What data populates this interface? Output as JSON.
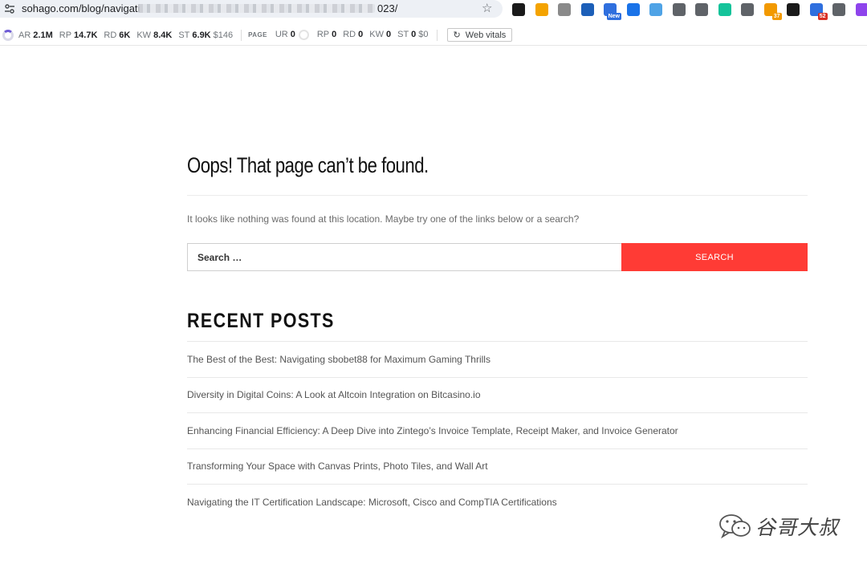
{
  "browser": {
    "url_prefix": "sohago.com/blog/navigati",
    "url_suffix": "023/",
    "extensions": [
      {
        "icon": "bookmark-arrow-icon",
        "color": "#1a1a1a",
        "badge": "",
        "badge_color": ""
      },
      {
        "icon": "sun-badge-icon",
        "color": "#f4a300",
        "badge": "",
        "badge_color": ""
      },
      {
        "icon": "document-icon",
        "color": "#8a8a8a",
        "badge": "",
        "badge_color": ""
      },
      {
        "icon": "puzzle-red-icon",
        "color": "#1c5fb8",
        "badge": "",
        "badge_color": "#d93025"
      },
      {
        "icon": "new-extension-icon",
        "color": "#2f6fde",
        "badge": "New",
        "badge_color": "#2f6fde"
      },
      {
        "icon": "circle-arrow-icon",
        "color": "#1a73e8",
        "badge": "",
        "badge_color": ""
      },
      {
        "icon": "react-atom-icon",
        "color": "#4fa3e6",
        "badge": "",
        "badge_color": ""
      },
      {
        "icon": "download-icon",
        "color": "#5f6368",
        "badge": "",
        "badge_color": ""
      },
      {
        "icon": "save-tray-icon",
        "color": "#5f6368",
        "badge": "",
        "badge_color": ""
      },
      {
        "icon": "grammarly-icon",
        "color": "#15c39a",
        "badge": "",
        "badge_color": ""
      },
      {
        "icon": "trash-icon",
        "color": "#5f6368",
        "badge": "",
        "badge_color": ""
      },
      {
        "icon": "counter-icon",
        "color": "#f29900",
        "badge": "37",
        "badge_color": "#f29900"
      },
      {
        "icon": "envelope-icon",
        "color": "#1a1a1a",
        "badge": "",
        "badge_color": ""
      },
      {
        "icon": "stats-icon",
        "color": "#2f6fde",
        "badge": "52",
        "badge_color": "#d93025"
      },
      {
        "icon": "eye-icon",
        "color": "#5f6368",
        "badge": "",
        "badge_color": ""
      },
      {
        "icon": "sparkle-icon",
        "color": "#8e44ec",
        "badge": "",
        "badge_color": ""
      }
    ]
  },
  "seo": {
    "site_metrics": [
      {
        "label": "AR",
        "value": "2.1M"
      },
      {
        "label": "RP",
        "value": "14.7K"
      },
      {
        "label": "RD",
        "value": "6K"
      },
      {
        "label": "KW",
        "value": "8.4K"
      },
      {
        "label": "ST",
        "value": "6.9K",
        "price": "$146"
      }
    ],
    "page_tag": "PAGE",
    "page_metrics": [
      {
        "label": "UR",
        "value": "0"
      },
      {
        "label": "RP",
        "value": "0"
      },
      {
        "label": "RD",
        "value": "0"
      },
      {
        "label": "KW",
        "value": "0"
      },
      {
        "label": "ST",
        "value": "0",
        "price": "$0"
      }
    ],
    "web_vitals_label": "Web vitals"
  },
  "page": {
    "title": "Oops! That page can’t be found.",
    "notice": "It looks like nothing was found at this location. Maybe try one of the links below or a search?",
    "search": {
      "placeholder": "Search …",
      "button_label": "SEARCH"
    },
    "recent_posts": {
      "heading": "RECENT POSTS",
      "items": [
        "The Best of the Best: Navigating sbobet88 for Maximum Gaming Thrills",
        "Diversity in Digital Coins: A Look at Altcoin Integration on Bitcasino.io",
        "Enhancing Financial Efficiency: A Deep Dive into Zintego’s Invoice Template, Receipt Maker, and Invoice Generator",
        "Transforming Your Space with Canvas Prints, Photo Tiles, and Wall Art",
        "Navigating the IT Certification Landscape: Microsoft, Cisco and CompTIA Certifications"
      ]
    }
  },
  "watermark": {
    "text": "谷哥大叔"
  },
  "colors": {
    "accent": "#ff3b35",
    "omnibox_bg": "#edf0f5"
  }
}
